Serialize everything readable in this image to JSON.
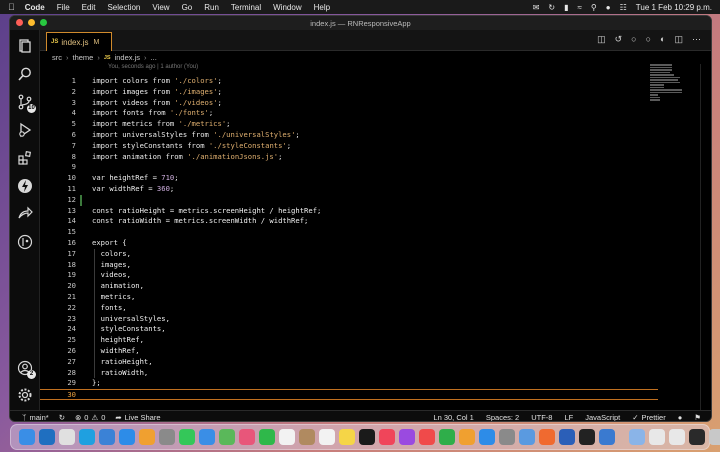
{
  "menubar": {
    "app": "Code",
    "items": [
      "File",
      "Edit",
      "Selection",
      "View",
      "Go",
      "Run",
      "Terminal",
      "Window",
      "Help"
    ],
    "datetime": "Tue 1 Feb  10:29 p.m."
  },
  "window": {
    "title": "index.js — RNResponsiveApp"
  },
  "tab": {
    "badge": "JS",
    "filename": "index.js",
    "modified": "M"
  },
  "breadcrumb": {
    "items": [
      "src",
      "theme",
      "index.js",
      "..."
    ],
    "badge": "JS"
  },
  "blame": "You, seconds ago | 1 author (You)",
  "activity": {
    "source_control_badge": "10",
    "accounts_badge": "2"
  },
  "code_lines": [
    {
      "n": "1",
      "parts": [
        [
          "kw",
          "import "
        ],
        [
          "prop",
          "colors "
        ],
        [
          "kw",
          "from "
        ],
        [
          "str",
          "'./colors'"
        ],
        [
          "prop",
          ";"
        ]
      ]
    },
    {
      "n": "2",
      "parts": [
        [
          "kw",
          "import "
        ],
        [
          "prop",
          "images "
        ],
        [
          "kw",
          "from "
        ],
        [
          "str",
          "'./images'"
        ],
        [
          "prop",
          ";"
        ]
      ]
    },
    {
      "n": "3",
      "parts": [
        [
          "kw",
          "import "
        ],
        [
          "prop",
          "videos "
        ],
        [
          "kw",
          "from "
        ],
        [
          "str",
          "'./videos'"
        ],
        [
          "prop",
          ";"
        ]
      ]
    },
    {
      "n": "4",
      "parts": [
        [
          "kw",
          "import "
        ],
        [
          "prop",
          "fonts "
        ],
        [
          "kw",
          "from "
        ],
        [
          "str",
          "'./fonts'"
        ],
        [
          "prop",
          ";"
        ]
      ]
    },
    {
      "n": "5",
      "parts": [
        [
          "kw",
          "import "
        ],
        [
          "prop",
          "metrics "
        ],
        [
          "kw",
          "from "
        ],
        [
          "str",
          "'./metrics'"
        ],
        [
          "prop",
          ";"
        ]
      ]
    },
    {
      "n": "6",
      "parts": [
        [
          "kw",
          "import "
        ],
        [
          "prop",
          "universalStyles "
        ],
        [
          "kw",
          "from "
        ],
        [
          "str",
          "'./universalStyles'"
        ],
        [
          "prop",
          ";"
        ]
      ]
    },
    {
      "n": "7",
      "parts": [
        [
          "kw",
          "import "
        ],
        [
          "prop",
          "styleConstants "
        ],
        [
          "kw",
          "from "
        ],
        [
          "str",
          "'./styleConstants'"
        ],
        [
          "prop",
          ";"
        ]
      ]
    },
    {
      "n": "8",
      "parts": [
        [
          "kw",
          "import "
        ],
        [
          "prop",
          "animation "
        ],
        [
          "kw",
          "from "
        ],
        [
          "str",
          "'./animationJsons.js'"
        ],
        [
          "prop",
          ";"
        ]
      ]
    },
    {
      "n": "9",
      "parts": []
    },
    {
      "n": "10",
      "parts": [
        [
          "kw",
          "var "
        ],
        [
          "prop",
          "heightRef = "
        ],
        [
          "num",
          "710"
        ],
        [
          "prop",
          ";"
        ]
      ]
    },
    {
      "n": "11",
      "parts": [
        [
          "kw",
          "var "
        ],
        [
          "prop",
          "widthRef = "
        ],
        [
          "num",
          "360"
        ],
        [
          "prop",
          ";"
        ]
      ]
    },
    {
      "n": "12",
      "parts": []
    },
    {
      "n": "13",
      "parts": [
        [
          "kw",
          "const "
        ],
        [
          "prop",
          "ratioHeight = metrics.screenHeight / heightRef;"
        ]
      ]
    },
    {
      "n": "14",
      "parts": [
        [
          "kw",
          "const "
        ],
        [
          "prop",
          "ratioWidth = metrics.screenWidth / widthRef;"
        ]
      ]
    },
    {
      "n": "15",
      "parts": []
    },
    {
      "n": "16",
      "parts": [
        [
          "kw",
          "export "
        ],
        [
          "prop",
          "{"
        ]
      ]
    },
    {
      "n": "17",
      "parts": [
        [
          "prop",
          "  colors,"
        ]
      ]
    },
    {
      "n": "18",
      "parts": [
        [
          "prop",
          "  images,"
        ]
      ]
    },
    {
      "n": "19",
      "parts": [
        [
          "prop",
          "  videos,"
        ]
      ]
    },
    {
      "n": "20",
      "parts": [
        [
          "prop",
          "  animation,"
        ]
      ]
    },
    {
      "n": "21",
      "parts": [
        [
          "prop",
          "  metrics,"
        ]
      ]
    },
    {
      "n": "22",
      "parts": [
        [
          "prop",
          "  fonts,"
        ]
      ]
    },
    {
      "n": "23",
      "parts": [
        [
          "prop",
          "  universalStyles,"
        ]
      ]
    },
    {
      "n": "24",
      "parts": [
        [
          "prop",
          "  styleConstants,"
        ]
      ]
    },
    {
      "n": "25",
      "parts": [
        [
          "prop",
          "  heightRef,"
        ]
      ]
    },
    {
      "n": "26",
      "parts": [
        [
          "prop",
          "  widthRef,"
        ]
      ]
    },
    {
      "n": "27",
      "parts": [
        [
          "prop",
          "  ratioHeight,"
        ]
      ]
    },
    {
      "n": "28",
      "parts": [
        [
          "prop",
          "  ratioWidth,"
        ]
      ]
    },
    {
      "n": "29",
      "parts": [
        [
          "prop",
          "};"
        ]
      ]
    },
    {
      "n": "30",
      "parts": []
    }
  ],
  "statusbar": {
    "branch": "main*",
    "errors": "0",
    "warnings": "0",
    "live_share": "Live Share",
    "position": "Ln 30, Col 1",
    "spaces": "Spaces: 2",
    "encoding": "UTF-8",
    "eol": "LF",
    "language": "JavaScript",
    "prettier": "Prettier"
  },
  "dock": {
    "apps": [
      {
        "name": "finder",
        "color": "#3a8ee6"
      },
      {
        "name": "vscode",
        "color": "#1f6fc0"
      },
      {
        "name": "chrome",
        "color": "#e0e0e0"
      },
      {
        "name": "skype",
        "color": "#1fa0e0"
      },
      {
        "name": "xcode",
        "color": "#3b82d6"
      },
      {
        "name": "safari",
        "color": "#2d8ce8"
      },
      {
        "name": "photos",
        "color": "#f0a030"
      },
      {
        "name": "launchpad",
        "color": "#8a8a8a"
      },
      {
        "name": "messages",
        "color": "#34c759"
      },
      {
        "name": "mail",
        "color": "#3a8ee6"
      },
      {
        "name": "maps",
        "color": "#5ab85a"
      },
      {
        "name": "photo-library",
        "color": "#e8567a"
      },
      {
        "name": "facetime",
        "color": "#2fb84a"
      },
      {
        "name": "calendar",
        "color": "#f2f2f2"
      },
      {
        "name": "contacts",
        "color": "#b08a60"
      },
      {
        "name": "reminders",
        "color": "#f2f2f2"
      },
      {
        "name": "notes",
        "color": "#f5d547"
      },
      {
        "name": "tv",
        "color": "#1a1a1a"
      },
      {
        "name": "music",
        "color": "#f0455a"
      },
      {
        "name": "podcasts",
        "color": "#9a4ae0"
      },
      {
        "name": "news",
        "color": "#f04a4a"
      },
      {
        "name": "numbers",
        "color": "#2fae4a"
      },
      {
        "name": "pages",
        "color": "#f0a030"
      },
      {
        "name": "app-store",
        "color": "#2d8ce8"
      },
      {
        "name": "settings",
        "color": "#8a8a8a"
      },
      {
        "name": "preview",
        "color": "#5a9ae0"
      },
      {
        "name": "postman",
        "color": "#f06a30"
      },
      {
        "name": "word",
        "color": "#2b5fb8"
      },
      {
        "name": "terminal",
        "color": "#222222"
      },
      {
        "name": "xcode-sim",
        "color": "#3a7ad0"
      }
    ],
    "right_items": [
      {
        "name": "downloads",
        "color": "#8ab4e8"
      },
      {
        "name": "window-1",
        "color": "#e8e8e8"
      },
      {
        "name": "window-2",
        "color": "#e8e8e8"
      },
      {
        "name": "window-3",
        "color": "#2a2a2a"
      },
      {
        "name": "trash",
        "color": "#c8c8c8"
      }
    ]
  }
}
